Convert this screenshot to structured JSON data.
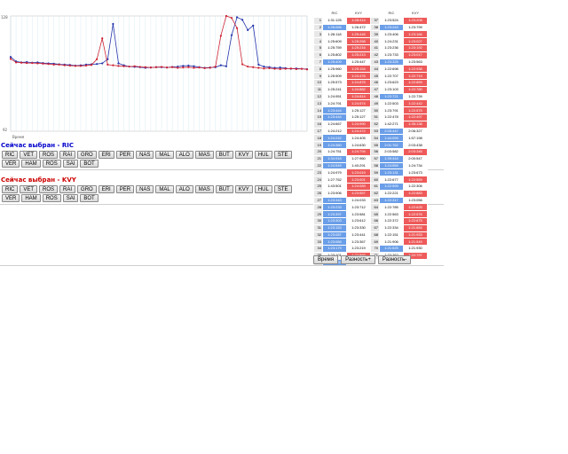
{
  "chart_data": {
    "type": "line",
    "ylim": [
      92,
      128
    ],
    "ytick_top": "128",
    "ytick_bottom": "92",
    "ylabel": "",
    "xlabel": "Время",
    "series": [
      {
        "color": "#2233aa",
        "values": [
          115.2,
          113.8,
          113.5,
          113.6,
          113.4,
          113.5,
          113.3,
          113.2,
          113.1,
          112.9,
          112.8,
          112.7,
          112.5,
          112.6,
          112.8,
          112.9,
          113.0,
          113.2,
          114.5,
          125.5,
          113.2,
          112.6,
          112.2,
          112.1,
          112.0,
          111.8,
          111.9,
          112.0,
          112.0,
          111.9,
          112.1,
          112.2,
          112.4,
          112.5,
          112.3,
          112.0,
          111.8,
          111.9,
          112.0,
          112.6,
          112.3,
          122.0,
          127.6,
          126.8,
          123.6,
          125.0,
          112.8,
          112.2,
          112.0,
          111.8,
          111.9,
          111.7,
          111.5,
          111.6,
          111.5,
          111.4
        ]
      },
      {
        "color": "#cc2233",
        "values": [
          114.6,
          113.5,
          113.4,
          113.3,
          113.3,
          113.2,
          113.1,
          113.0,
          112.8,
          112.8,
          112.6,
          112.5,
          112.4,
          112.4,
          112.5,
          112.7,
          114.5,
          121.0,
          112.8,
          112.6,
          112.4,
          112.3,
          112.2,
          112.3,
          112.1,
          112.0,
          111.9,
          112.0,
          112.1,
          111.9,
          112.0,
          111.8,
          111.9,
          112.0,
          111.8,
          111.9,
          111.7,
          111.8,
          112.2,
          121.8,
          128.0,
          127.4,
          124.2,
          112.9,
          112.2,
          112.0,
          111.8,
          111.6,
          111.7,
          111.5,
          111.4,
          111.5,
          111.6,
          111.4,
          111.5,
          111.3
        ]
      }
    ]
  },
  "selections": [
    {
      "title": "Сейчас выбран - RIC",
      "variant": "ric"
    },
    {
      "title": "Сейчас выбран - KVY",
      "variant": "kvy"
    }
  ],
  "buttons_row1": [
    "RIC",
    "VET",
    "ROS",
    "RAI",
    "GRO",
    "ERI",
    "PER",
    "NAS",
    "MAL",
    "ALO",
    "MAS",
    "BUT",
    "KVY",
    "HUL",
    "STE"
  ],
  "buttons_row2": [
    "VER",
    "HAM",
    "ROS",
    "SAI",
    "BOT"
  ],
  "table": {
    "headers": [
      "RIC",
      "KVY",
      "RIC",
      "KVY"
    ],
    "left": [
      [
        "1",
        "1:31:125",
        "1:28:414"
      ],
      [
        "2",
        "1:26:066",
        "1:26:472"
      ],
      [
        "3",
        "1:26:118",
        "1:25:445"
      ],
      [
        "4",
        "1:25:609",
        "1:25:258"
      ],
      [
        "5",
        "1:25:759",
        "1:25:216"
      ],
      [
        "6",
        "1:25:802",
        "1:25:213"
      ],
      [
        "7",
        "1:25:409",
        "1:25:447"
      ],
      [
        "8",
        "1:25:960",
        "1:25:154"
      ],
      [
        "9",
        "1:25:909",
        "1:24:476"
      ],
      [
        "10",
        "1:25:573",
        "1:24:875"
      ],
      [
        "11",
        "1:25:241",
        "1:24:882"
      ],
      [
        "12",
        "1:24:951",
        "1:24:814"
      ],
      [
        "13",
        "1:24:791",
        "1:24:574"
      ],
      [
        "14",
        "1:23:444",
        "1:25:127"
      ],
      [
        "15",
        "1:23:444",
        "1:25:127"
      ],
      [
        "16",
        "1:24:667",
        "1:24:990"
      ],
      [
        "17",
        "1:24:212",
        "1:24:472"
      ],
      [
        "18",
        "1:24:242",
        "1:24:405"
      ],
      [
        "19",
        "1:24:360",
        "1:24:630"
      ],
      [
        "20",
        "1:24:751",
        "1:24:794"
      ],
      [
        "21",
        "1:34:918",
        "1:27:960"
      ],
      [
        "22",
        "1:24:549",
        "1:40:291"
      ],
      [
        "23",
        "1:24:979",
        "1:23:019"
      ],
      [
        "24",
        "1:27:752",
        "1:23:001"
      ],
      [
        "25",
        "1:43:501",
        "1:24:083"
      ],
      [
        "26",
        "1:23:906",
        "1:23:557"
      ],
      [
        "27",
        "1:23:343",
        "1:24:033"
      ],
      [
        "28",
        "1:23:233",
        "1:23:712"
      ],
      [
        "29",
        "1:23:397",
        "1:23:581"
      ],
      [
        "30",
        "1:23:303",
        "1:23:612"
      ],
      [
        "31",
        "1:23:153",
        "1:23:330"
      ],
      [
        "32",
        "1:23:087",
        "1:23:441"
      ],
      [
        "33",
        "1:23:066",
        "1:23:367"
      ],
      [
        "34",
        "1:23:179",
        "1:23:219"
      ],
      [
        "35",
        "1:23:101",
        "1:22:865"
      ],
      [
        "36",
        "1:23:039",
        "1:23:096"
      ]
    ],
    "right": [
      [
        "37",
        "1:23:524",
        "1:23:208"
      ],
      [
        "38",
        "1:23:243",
        "1:23:799"
      ],
      [
        "39",
        "1:23:406",
        "1:23:166"
      ],
      [
        "40",
        "1:24:231",
        "1:23:027"
      ],
      [
        "41",
        "1:23:236",
        "1:23:192"
      ],
      [
        "42",
        "1:23:733",
        "1:23:017"
      ],
      [
        "43",
        "1:23:325",
        "1:23:563"
      ],
      [
        "44",
        "1:22:698",
        "1:22:938"
      ],
      [
        "45",
        "1:22:707",
        "1:22:719"
      ],
      [
        "46",
        "1:23:623",
        "1:22:859"
      ],
      [
        "47",
        "1:23:103",
        "1:22:780"
      ],
      [
        "48",
        "1:22:721",
        "1:22:739"
      ],
      [
        "49",
        "1:22:503",
        "1:22:442"
      ],
      [
        "50",
        "1:23:791",
        "1:22:575"
      ],
      [
        "51",
        "1:22:478",
        "1:22:497"
      ],
      [
        "52",
        "1:42:271",
        "1:35:138"
      ],
      [
        "53",
        "2:05:447",
        "2:06:327"
      ],
      [
        "54",
        "1:44:099",
        "1:57:198"
      ],
      [
        "55",
        "2:01:762",
        "2:03:438"
      ],
      [
        "56",
        "2:03:582",
        "2:03:346"
      ],
      [
        "57",
        "1:39:444",
        "2:00:547"
      ],
      [
        "58",
        "1:24:559",
        "1:24:734"
      ],
      [
        "59",
        "1:23:131",
        "1:23:673"
      ],
      [
        "60",
        "1:22:677",
        "1:22:559"
      ],
      [
        "61",
        "1:22:599",
        "1:22:306"
      ],
      [
        "62",
        "1:22:221",
        "1:22:883"
      ],
      [
        "63",
        "1:22:317",
        "1:23:056"
      ],
      [
        "64",
        "1:22:785",
        "1:22:625"
      ],
      [
        "65",
        "1:22:563",
        "1:22:576"
      ],
      [
        "66",
        "1:22:372",
        "1:22:875"
      ],
      [
        "67",
        "1:22:334",
        "1:21:684"
      ],
      [
        "68",
        "1:22:151",
        "1:21:933"
      ],
      [
        "69",
        "1:21:906",
        "1:21:549"
      ],
      [
        "70",
        "1:21:625",
        "1:21:930"
      ],
      [
        "71",
        "1:22:762",
        "1:22:797"
      ]
    ],
    "left_styles": [
      [
        "plain",
        "red"
      ],
      [
        "blue",
        "plain"
      ],
      [
        "plain",
        "red"
      ],
      [
        "plain",
        "red"
      ],
      [
        "plain",
        "red"
      ],
      [
        "plain",
        "red"
      ],
      [
        "blue",
        "plain"
      ],
      [
        "plain",
        "red"
      ],
      [
        "plain",
        "red"
      ],
      [
        "plain",
        "red"
      ],
      [
        "plain",
        "red"
      ],
      [
        "plain",
        "red"
      ],
      [
        "plain",
        "red"
      ],
      [
        "blue",
        "plain"
      ],
      [
        "blue",
        "plain"
      ],
      [
        "plain",
        "red"
      ],
      [
        "plain",
        "red"
      ],
      [
        "blue",
        "plain"
      ],
      [
        "blue",
        "plain"
      ],
      [
        "plain",
        "red"
      ],
      [
        "blue",
        "plain"
      ],
      [
        "blue",
        "plain"
      ],
      [
        "plain",
        "red"
      ],
      [
        "plain",
        "red"
      ],
      [
        "plain",
        "red"
      ],
      [
        "plain",
        "red"
      ],
      [
        "blue",
        "plain"
      ],
      [
        "blue",
        "plain"
      ],
      [
        "blue",
        "plain"
      ],
      [
        "blue",
        "plain"
      ],
      [
        "blue",
        "plain"
      ],
      [
        "blue",
        "plain"
      ],
      [
        "blue",
        "plain"
      ],
      [
        "blue",
        "plain"
      ],
      [
        "plain",
        "red"
      ],
      [
        "blue",
        "plain"
      ]
    ],
    "right_styles": [
      [
        "plain",
        "red"
      ],
      [
        "blue",
        "plain"
      ],
      [
        "plain",
        "red"
      ],
      [
        "plain",
        "red"
      ],
      [
        "plain",
        "red"
      ],
      [
        "plain",
        "red"
      ],
      [
        "blue",
        "plain"
      ],
      [
        "plain",
        "red"
      ],
      [
        "plain",
        "red"
      ],
      [
        "plain",
        "red"
      ],
      [
        "plain",
        "red"
      ],
      [
        "blue",
        "plain"
      ],
      [
        "plain",
        "red"
      ],
      [
        "plain",
        "red"
      ],
      [
        "plain",
        "red"
      ],
      [
        "plain",
        "red"
      ],
      [
        "blue",
        "plain"
      ],
      [
        "blue",
        "plain"
      ],
      [
        "blue",
        "plain"
      ],
      [
        "plain",
        "red"
      ],
      [
        "blue",
        "plain"
      ],
      [
        "blue",
        "plain"
      ],
      [
        "blue",
        "plain"
      ],
      [
        "plain",
        "red"
      ],
      [
        "blue",
        "plain"
      ],
      [
        "plain",
        "red"
      ],
      [
        "blue",
        "plain"
      ],
      [
        "plain",
        "red"
      ],
      [
        "plain",
        "red"
      ],
      [
        "plain",
        "red"
      ],
      [
        "plain",
        "red"
      ],
      [
        "plain",
        "red"
      ],
      [
        "plain",
        "red"
      ],
      [
        "blue",
        "plain"
      ],
      [
        "plain",
        "red"
      ]
    ]
  },
  "bottom_buttons": [
    "Время",
    "Разность+",
    "Разность-"
  ]
}
